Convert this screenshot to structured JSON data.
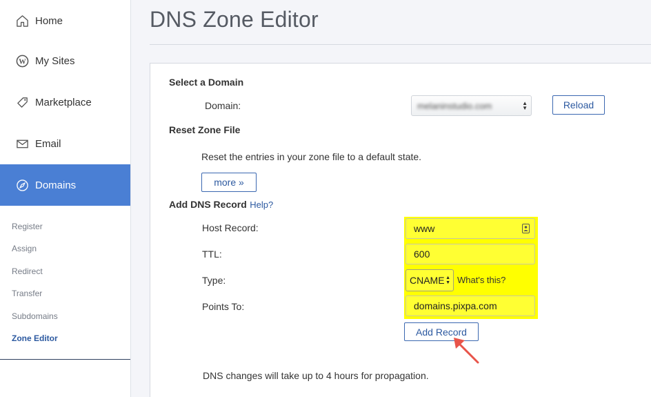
{
  "sidebar": {
    "items": [
      {
        "label": "Home",
        "icon": "home-icon"
      },
      {
        "label": "My Sites",
        "icon": "wordpress-icon"
      },
      {
        "label": "Marketplace",
        "icon": "tag-icon"
      },
      {
        "label": "Email",
        "icon": "envelope-icon"
      },
      {
        "label": "Domains",
        "icon": "compass-icon",
        "active": true
      }
    ],
    "subitems": [
      "Register",
      "Assign",
      "Redirect",
      "Transfer",
      "Subdomains",
      "Zone Editor"
    ],
    "active_subitem": "Zone Editor"
  },
  "page": {
    "title": "DNS Zone Editor"
  },
  "select_domain": {
    "heading": "Select a Domain",
    "domain_label": "Domain:",
    "domain_value": "melaninstudio.com",
    "reload_label": "Reload"
  },
  "reset_zone": {
    "heading": "Reset Zone File",
    "description": "Reset the entries in your zone file to a default state.",
    "more_label": "more »"
  },
  "add_record": {
    "heading": "Add DNS Record",
    "help_label": "Help?",
    "host_label": "Host Record:",
    "host_value": "www",
    "ttl_label": "TTL:",
    "ttl_value": "600",
    "type_label": "Type:",
    "type_value": "CNAME",
    "whats_this_label": "What's this?",
    "points_label": "Points To:",
    "points_value": "domains.pixpa.com",
    "add_label": "Add Record",
    "note": "DNS changes will take up to 4 hours for propagation."
  },
  "colors": {
    "accent": "#4a7fd4",
    "link": "#2c59a0",
    "highlight": "#ffff00",
    "annotation_arrow": "#e8544a"
  }
}
